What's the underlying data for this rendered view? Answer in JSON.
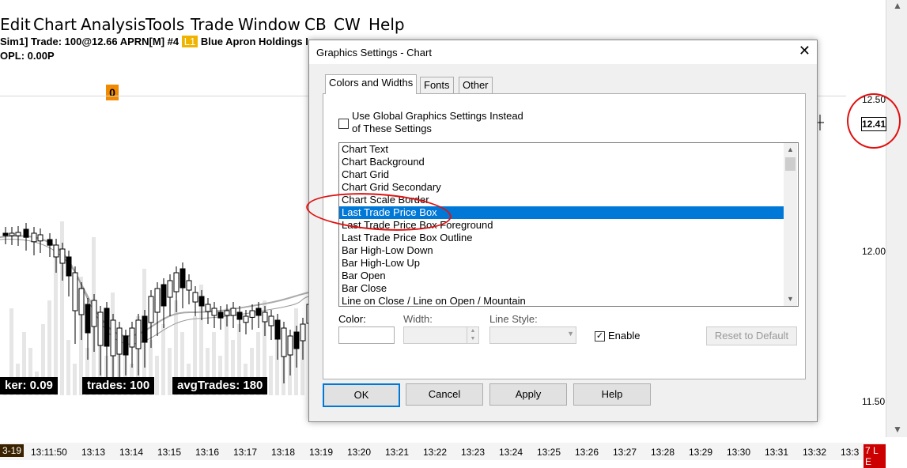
{
  "menu": [
    "Edit",
    "Chart",
    "Analysis",
    "Tools",
    "Trade",
    "Window",
    "CB",
    "CW",
    "Help"
  ],
  "chart": {
    "info_sim": "Sim1]",
    "info_trade": "Trade: 100@12.66",
    "info_symbol": "APRN[M] #4",
    "info_l1": "L1",
    "info_name": "Blue Apron Holdings Inc",
    "info_opl": "OPL: 0.00P",
    "badge": "0",
    "y_labels": [
      "12.50",
      "12.00",
      "11.50"
    ],
    "last_price": "12.41",
    "stats": [
      {
        "text": "ker:  0.09"
      },
      {
        "text": "trades:  100"
      },
      {
        "text": "avgTrades:  180"
      }
    ],
    "time_first": "3-19",
    "time_labels": [
      "13:11:50",
      "13:13",
      "13:14",
      "13:15",
      "13:16",
      "13:17",
      "13:18",
      "13:19",
      "13:20",
      "13:21",
      "13:22",
      "13:23",
      "13:24",
      "13:25",
      "13:26",
      "13:27",
      "13:28",
      "13:29",
      "13:30",
      "13:31",
      "13:32"
    ],
    "time_last_label": "13:3",
    "time_last_box": "7 L E"
  },
  "dialog": {
    "title": "Graphics Settings  - Chart",
    "tabs": [
      "Colors and Widths",
      "Fonts",
      "Other"
    ],
    "global_checkbox_line1": "Use Global Graphics Settings Instead",
    "global_checkbox_line2": "of These Settings",
    "items": [
      "Chart Text",
      "Chart Background",
      "Chart Grid",
      "Chart Grid Secondary",
      "Chart Scale Border",
      "Last Trade Price Box",
      "Last Trade Price Box Foreground",
      "Last Trade Price Box Outline",
      "Bar High-Low Down",
      "Bar High-Low Up",
      "Bar Open",
      "Bar Close",
      "Line on Close / Line on Open / Mountain"
    ],
    "selected_index": 5,
    "color_label": "Color:",
    "width_label": "Width:",
    "line_style_label": "Line Style:",
    "enable_label": "Enable",
    "enable_checked": true,
    "reset_button": "Reset to Default",
    "ok_button": "OK",
    "cancel_button": "Cancel",
    "apply_button": "Apply",
    "help_button": "Help"
  },
  "colors": {
    "selection": "#0078d7",
    "annotation": "#e01010",
    "badge": "#f08a00"
  }
}
